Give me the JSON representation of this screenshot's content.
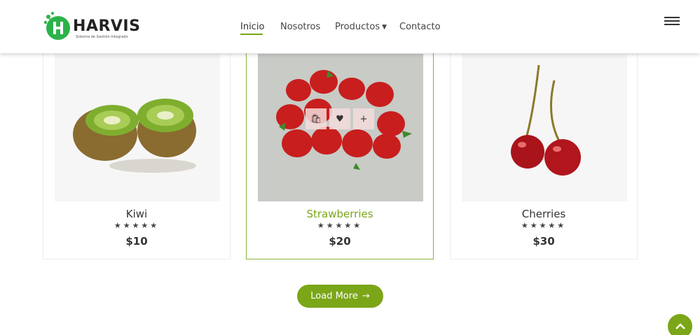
{
  "brand": {
    "name": "HARVIS",
    "tagline": "Sistema de Gestión Integrado"
  },
  "nav": {
    "items": [
      {
        "label": "Inicio",
        "active": true
      },
      {
        "label": "Nosotros"
      },
      {
        "label": "Productos",
        "has_dropdown": true
      },
      {
        "label": "Contacto"
      }
    ]
  },
  "products": [
    {
      "name": "Kiwi",
      "stars": "★★★★★",
      "price": "$10"
    },
    {
      "name": "Strawberries",
      "stars": "★★★★★",
      "price": "$20"
    },
    {
      "name": "Cherries",
      "stars": "★★★★★",
      "price": "$30"
    }
  ],
  "actions": {
    "cart_icon": "bag-icon",
    "wishlist_icon": "heart-icon",
    "quickview_icon": "plus-icon"
  },
  "load_more": {
    "label": "Load More",
    "arrow": "→"
  },
  "colors": {
    "accent": "#7aa617",
    "text": "#333333"
  }
}
